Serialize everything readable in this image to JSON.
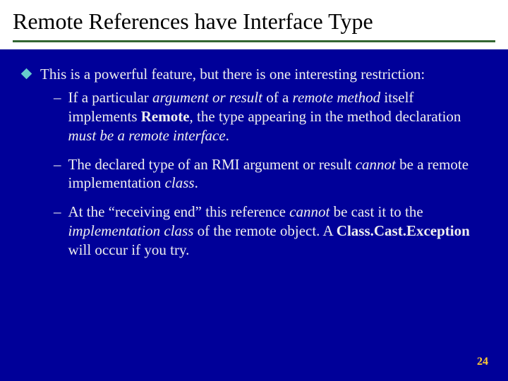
{
  "slide": {
    "title": "Remote References have Interface Type",
    "page_number": "24",
    "bullet1": {
      "text_a": "This is a powerful feature, but there is one interesting restriction:"
    },
    "sub1": {
      "a": "If a particular ",
      "b": "argument or result",
      "c": " of a ",
      "d": "remote method",
      "e": " itself implements ",
      "f": "Remote",
      "g": ", the type appearing in the method declaration ",
      "h": "must be a remote interface",
      "i": "."
    },
    "sub2": {
      "a": "The declared type of an RMI argument or result ",
      "b": "cannot",
      "c": " be a remote implementation ",
      "d": "class",
      "e": "."
    },
    "sub3": {
      "a": "At the “receiving end” this reference ",
      "b": "cannot",
      "c": " be cast it to the ",
      "d": "implementation class",
      "e": " of the remote object.  A ",
      "f": "Class.Cast.Exception",
      "g": " will occur if you try."
    }
  }
}
